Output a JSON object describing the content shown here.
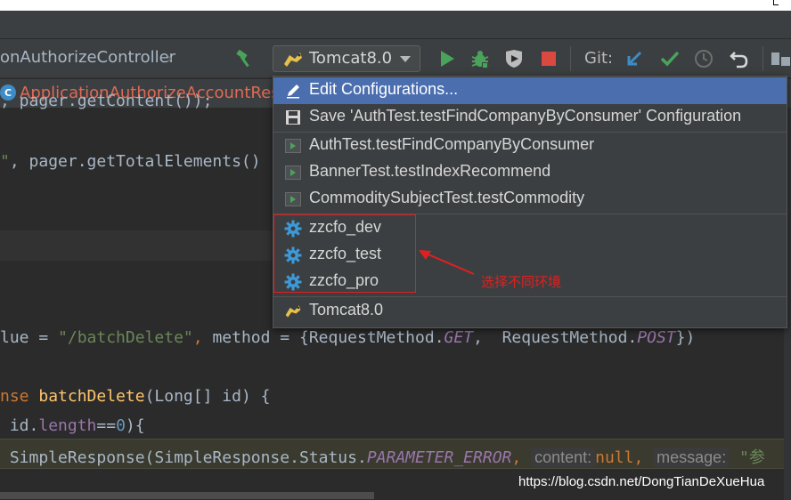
{
  "toolbar": {
    "breadcrumb": "onAuthorizeController",
    "run_config": "Tomcat8.0",
    "git_label": "Git:"
  },
  "tab": {
    "icon_letter": "C",
    "label": "ApplicationAuthorizeAccountRes"
  },
  "code": {
    "line1_a": ", pager.getContent());",
    "line2_str": "\"",
    "line2_rest": ", pager.getTotalElements()",
    "line4_ident": "lue",
    "line4_eq": " = ",
    "line4_str": "\"/batchDelete\"",
    "line4_comma": ", ",
    "line4_method": "method",
    "line4_brace": " = {RequestMethod.",
    "line4_get": "GET",
    "line4_mid": ",  RequestMethod.",
    "line4_post": "POST",
    "line4_end": "})",
    "line5_kw": "nse ",
    "line5_fn": "batchDelete",
    "line5_rest": "(Long[] id) {",
    "line6_a": " id.",
    "line6_field": "length",
    "line6_b": "==",
    "line6_num": "0",
    "line6_c": "){",
    "line7_a": " SimpleResponse(SimpleResponse.Status.",
    "line7_const": "PARAMETER_ERROR",
    "line7_comma": ", ",
    "line7_hint_content": "content:",
    "line7_null": "null",
    "line7_comma2": ", ",
    "line7_hint_message": "message:",
    "line7_str": " \"参"
  },
  "popup": {
    "items": [
      {
        "label": "Edit Configurations...",
        "icon": "pencil-icon"
      },
      {
        "label": "Save 'AuthTest.testFindCompanyByConsumer' Configuration",
        "icon": "save-icon"
      },
      {
        "label": "AuthTest.testFindCompanyByConsumer",
        "icon": "junit-config-icon"
      },
      {
        "label": "BannerTest.testIndexRecommend",
        "icon": "junit-config-icon"
      },
      {
        "label": "CommoditySubjectTest.testCommodity",
        "icon": "junit-config-icon"
      },
      {
        "label": "zzcfo_dev",
        "icon": "gear-icon"
      },
      {
        "label": "zzcfo_test",
        "icon": "gear-icon"
      },
      {
        "label": "zzcfo_pro",
        "icon": "gear-icon"
      },
      {
        "label": "Tomcat8.0",
        "icon": "tomcat-icon"
      }
    ]
  },
  "annotation": {
    "text": "选择不同环境",
    "color": "#e02020"
  },
  "watermark": "https://blog.csdn.net/DongTianDeXueHua",
  "colors": {
    "selection": "#4b6eaf",
    "run_green": "#49a35a",
    "stop_red": "#d9493f",
    "vcs_blue": "#3d8cc7"
  }
}
